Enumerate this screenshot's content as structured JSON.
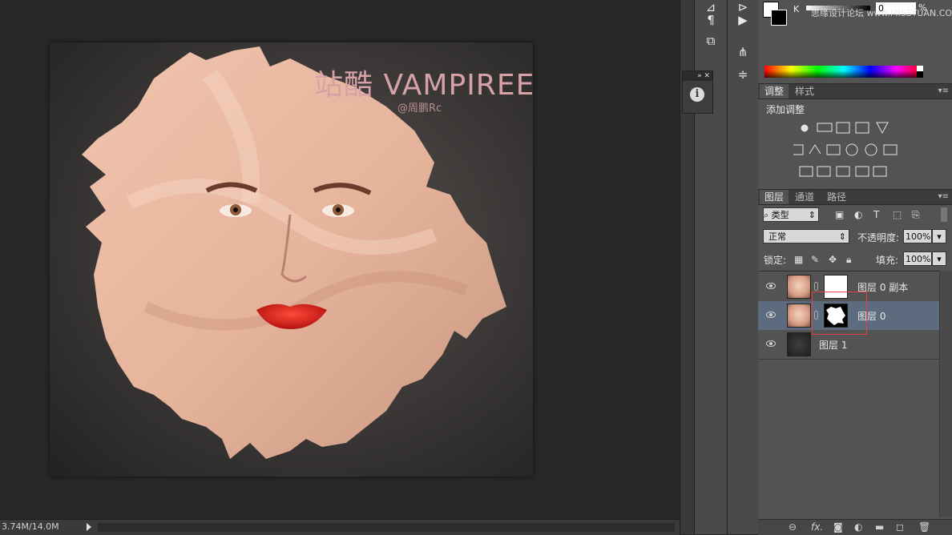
{
  "document": {
    "title_cn": "站酷",
    "title_en": "VAMPIREE",
    "author": "@周鹏Rc"
  },
  "status_bar": {
    "doc_size": "3.74M/14.0M"
  },
  "color_panel": {
    "channel_label": "K",
    "value": "0",
    "percent": "%",
    "watermark": "思缘设计论坛 www.MISSYUAN.COM"
  },
  "adjustments_panel": {
    "tabs": [
      "调整",
      "样式"
    ],
    "active_tab": "调整",
    "heading": "添加调整"
  },
  "layers_panel": {
    "tabs": [
      "图层",
      "通道",
      "路径"
    ],
    "active_tab": "图层",
    "filter_kind": "类型",
    "blend_mode": "正常",
    "opacity_label": "不透明度:",
    "opacity_value": "100%",
    "lock_label": "锁定:",
    "fill_label": "填充:",
    "fill_value": "100%",
    "layers": [
      {
        "name": "图层 0 副本",
        "thumbnail": "face",
        "mask": "white",
        "visible": true,
        "selected": false
      },
      {
        "name": "图层 0",
        "thumbnail": "face",
        "mask": "blob",
        "visible": true,
        "selected": true
      },
      {
        "name": "图层 1",
        "thumbnail": "dark",
        "mask": "",
        "visible": true,
        "selected": false
      }
    ]
  },
  "colors": {
    "canvas_bg": "#282828",
    "panel_bg": "#535353",
    "selected_layer": "#5d6b7f",
    "highlight_box": "#e24040"
  }
}
